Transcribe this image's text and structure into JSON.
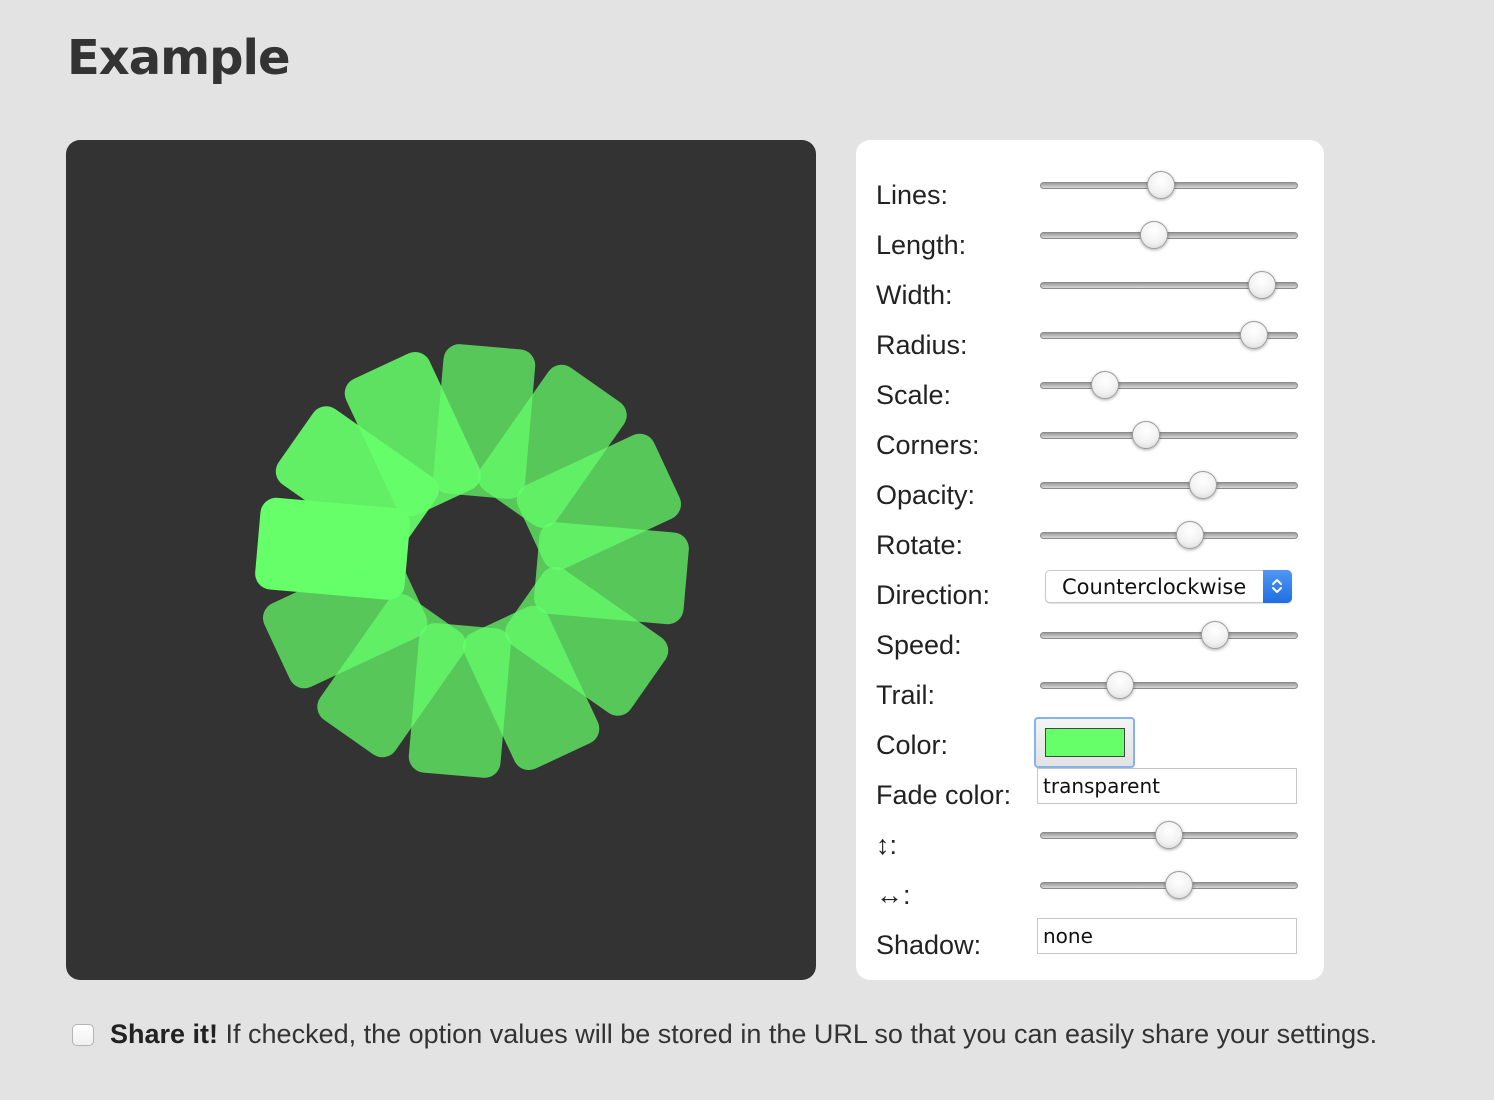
{
  "page": {
    "title": "Example"
  },
  "spinner": {
    "lines": 12,
    "color": "#66ff6a",
    "faded_color": "#4cb75a",
    "background": "#333333"
  },
  "controls": {
    "lines_label": "Lines:",
    "lines_value": 0.47,
    "length_label": "Length:",
    "length_value": 0.44,
    "width_label": "Width:",
    "width_value": 0.86,
    "radius_label": "Radius:",
    "radius_value": 0.83,
    "scale_label": "Scale:",
    "scale_value": 0.25,
    "corners_label": "Corners:",
    "corners_value": 0.41,
    "opacity_label": "Opacity:",
    "opacity_value": 0.63,
    "rotate_label": "Rotate:",
    "rotate_value": 0.58,
    "direction_label": "Direction:",
    "direction_value": "Counterclockwise",
    "speed_label": "Speed:",
    "speed_value": 0.68,
    "trail_label": "Trail:",
    "trail_value": 0.31,
    "color_label": "Color:",
    "color_value": "#66ff6a",
    "fade_color_label": "Fade color:",
    "fade_color_value": "transparent",
    "top_label": "↕:",
    "top_value": 0.5,
    "left_label": "↔:",
    "left_value": 0.54,
    "shadow_label": "Shadow:",
    "shadow_value": "none"
  },
  "share": {
    "strong": "Share it!",
    "text": " If checked, the option values will be stored in the URL so that you can easily share your settings.",
    "checked": false
  }
}
